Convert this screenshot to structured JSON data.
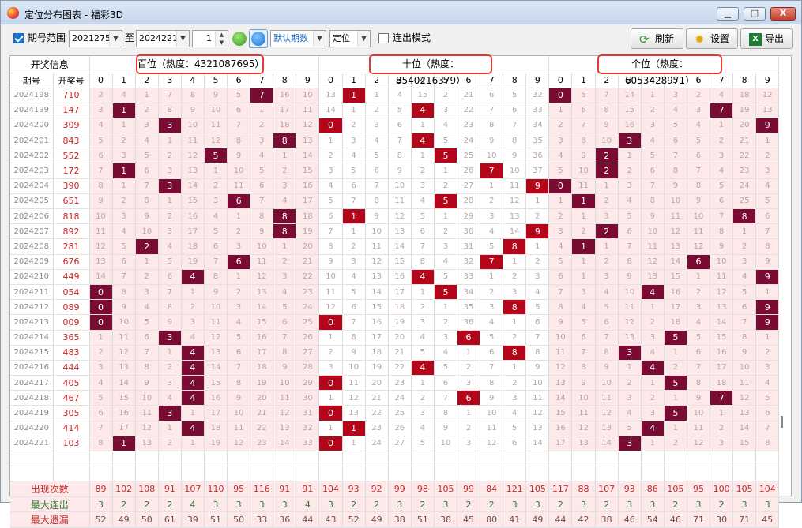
{
  "window": {
    "title": "定位分布图表 - 福彩3D",
    "min": "▁",
    "max": "□",
    "close": "X"
  },
  "toolbar": {
    "period_range_label": "期号范围",
    "from": "2021275",
    "to_label": "至",
    "to": "2024221",
    "step": "1",
    "default_periods": "默认期数",
    "position": "定位",
    "consecutive_label": "连出模式",
    "refresh": "刷新",
    "settings": "设置",
    "export": "导出"
  },
  "table": {
    "info_header": "开奖信息",
    "col_period": "期号",
    "col_number": "开奖号",
    "groups": [
      {
        "label": "百位（热度：4321087695）"
      },
      {
        "label": "十位（热度：8540216379）"
      },
      {
        "label": "个位（热度：6053428971）"
      }
    ],
    "digits": [
      "0",
      "1",
      "2",
      "3",
      "4",
      "5",
      "6",
      "7",
      "8",
      "9"
    ],
    "rows": [
      {
        "period": "2024198",
        "number": "710",
        "cells": [
          [
            2,
            4,
            1,
            7,
            8,
            9,
            5,
            7,
            16,
            10
          ],
          [
            13,
            1,
            1,
            4,
            15,
            2,
            21,
            6,
            5,
            32
          ],
          [
            0,
            5,
            7,
            14,
            1,
            3,
            2,
            4,
            18,
            12
          ]
        ]
      },
      {
        "period": "2024199",
        "number": "147",
        "cells": [
          [
            3,
            1,
            2,
            8,
            9,
            10,
            6,
            1,
            17,
            11
          ],
          [
            14,
            1,
            2,
            5,
            4,
            3,
            22,
            7,
            6,
            33
          ],
          [
            1,
            6,
            8,
            15,
            2,
            4,
            3,
            7,
            19,
            13
          ]
        ]
      },
      {
        "period": "2024200",
        "number": "309",
        "cells": [
          [
            4,
            1,
            3,
            3,
            10,
            11,
            7,
            2,
            18,
            12
          ],
          [
            0,
            2,
            3,
            6,
            1,
            4,
            23,
            8,
            7,
            34
          ],
          [
            2,
            7,
            9,
            16,
            3,
            5,
            4,
            1,
            20,
            9
          ]
        ]
      },
      {
        "period": "2024201",
        "number": "843",
        "cells": [
          [
            5,
            2,
            4,
            1,
            11,
            12,
            8,
            3,
            8,
            13
          ],
          [
            1,
            3,
            4,
            7,
            4,
            5,
            24,
            9,
            8,
            35
          ],
          [
            3,
            8,
            10,
            3,
            4,
            6,
            5,
            2,
            21,
            1
          ]
        ]
      },
      {
        "period": "2024202",
        "number": "552",
        "cells": [
          [
            6,
            3,
            5,
            2,
            12,
            5,
            9,
            4,
            1,
            14
          ],
          [
            2,
            4,
            5,
            8,
            1,
            5,
            25,
            10,
            9,
            36
          ],
          [
            4,
            9,
            2,
            1,
            5,
            7,
            6,
            3,
            22,
            2
          ]
        ]
      },
      {
        "period": "2024203",
        "number": "172",
        "cells": [
          [
            7,
            1,
            6,
            3,
            13,
            1,
            10,
            5,
            2,
            15
          ],
          [
            3,
            5,
            6,
            9,
            2,
            1,
            26,
            7,
            10,
            37
          ],
          [
            5,
            10,
            2,
            2,
            6,
            8,
            7,
            4,
            23,
            3
          ]
        ]
      },
      {
        "period": "2024204",
        "number": "390",
        "cells": [
          [
            8,
            1,
            7,
            3,
            14,
            2,
            11,
            6,
            3,
            16
          ],
          [
            4,
            6,
            7,
            10,
            3,
            2,
            27,
            1,
            11,
            9
          ],
          [
            0,
            11,
            1,
            3,
            7,
            9,
            8,
            5,
            24,
            4
          ]
        ]
      },
      {
        "period": "2024205",
        "number": "651",
        "cells": [
          [
            9,
            2,
            8,
            1,
            15,
            3,
            6,
            7,
            4,
            17
          ],
          [
            5,
            7,
            8,
            11,
            4,
            5,
            28,
            2,
            12,
            1
          ],
          [
            1,
            1,
            2,
            4,
            8,
            10,
            9,
            6,
            25,
            5
          ]
        ]
      },
      {
        "period": "2024206",
        "number": "818",
        "cells": [
          [
            10,
            3,
            9,
            2,
            16,
            4,
            1,
            8,
            8,
            18
          ],
          [
            6,
            1,
            9,
            12,
            5,
            1,
            29,
            3,
            13,
            2
          ],
          [
            2,
            1,
            3,
            5,
            9,
            11,
            10,
            7,
            8,
            6
          ]
        ]
      },
      {
        "period": "2024207",
        "number": "892",
        "cells": [
          [
            11,
            4,
            10,
            3,
            17,
            5,
            2,
            9,
            8,
            19
          ],
          [
            7,
            1,
            10,
            13,
            6,
            2,
            30,
            4,
            14,
            9
          ],
          [
            3,
            2,
            2,
            6,
            10,
            12,
            11,
            8,
            1,
            7
          ]
        ]
      },
      {
        "period": "2024208",
        "number": "281",
        "cells": [
          [
            12,
            5,
            2,
            4,
            18,
            6,
            3,
            10,
            1,
            20
          ],
          [
            8,
            2,
            11,
            14,
            7,
            3,
            31,
            5,
            8,
            1
          ],
          [
            4,
            1,
            1,
            7,
            11,
            13,
            12,
            9,
            2,
            8
          ]
        ]
      },
      {
        "period": "2024209",
        "number": "676",
        "cells": [
          [
            13,
            6,
            1,
            5,
            19,
            7,
            6,
            11,
            2,
            21
          ],
          [
            9,
            3,
            12,
            15,
            8,
            4,
            32,
            7,
            1,
            2
          ],
          [
            5,
            1,
            2,
            8,
            12,
            14,
            6,
            10,
            3,
            9
          ]
        ]
      },
      {
        "period": "2024210",
        "number": "449",
        "cells": [
          [
            14,
            7,
            2,
            6,
            4,
            8,
            1,
            12,
            3,
            22
          ],
          [
            10,
            4,
            13,
            16,
            4,
            5,
            33,
            1,
            2,
            3
          ],
          [
            6,
            1,
            3,
            9,
            13,
            15,
            1,
            11,
            4,
            9
          ]
        ]
      },
      {
        "period": "2024211",
        "number": "054",
        "cells": [
          [
            0,
            8,
            3,
            7,
            1,
            9,
            2,
            13,
            4,
            23
          ],
          [
            11,
            5,
            14,
            17,
            1,
            5,
            34,
            2,
            3,
            4
          ],
          [
            7,
            3,
            4,
            10,
            4,
            16,
            2,
            12,
            5,
            1
          ]
        ]
      },
      {
        "period": "2024212",
        "number": "089",
        "cells": [
          [
            0,
            9,
            4,
            8,
            2,
            10,
            3,
            14,
            5,
            24
          ],
          [
            12,
            6,
            15,
            18,
            2,
            1,
            35,
            3,
            8,
            5
          ],
          [
            8,
            4,
            5,
            11,
            1,
            17,
            3,
            13,
            6,
            9
          ]
        ]
      },
      {
        "period": "2024213",
        "number": "009",
        "cells": [
          [
            0,
            10,
            5,
            9,
            3,
            11,
            4,
            15,
            6,
            25
          ],
          [
            0,
            7,
            16,
            19,
            3,
            2,
            36,
            4,
            1,
            6
          ],
          [
            9,
            5,
            6,
            12,
            2,
            18,
            4,
            14,
            7,
            9
          ]
        ]
      },
      {
        "period": "2024214",
        "number": "365",
        "cells": [
          [
            1,
            11,
            6,
            3,
            4,
            12,
            5,
            16,
            7,
            26
          ],
          [
            1,
            8,
            17,
            20,
            4,
            3,
            6,
            5,
            2,
            7
          ],
          [
            10,
            6,
            7,
            13,
            3,
            5,
            5,
            15,
            8,
            1
          ]
        ]
      },
      {
        "period": "2024215",
        "number": "483",
        "cells": [
          [
            2,
            12,
            7,
            1,
            4,
            13,
            6,
            17,
            8,
            27
          ],
          [
            2,
            9,
            18,
            21,
            5,
            4,
            1,
            6,
            8,
            8
          ],
          [
            11,
            7,
            8,
            3,
            4,
            1,
            6,
            16,
            9,
            2
          ]
        ]
      },
      {
        "period": "2024216",
        "number": "444",
        "cells": [
          [
            3,
            13,
            8,
            2,
            4,
            14,
            7,
            18,
            9,
            28
          ],
          [
            3,
            10,
            19,
            22,
            4,
            5,
            2,
            7,
            1,
            9
          ],
          [
            12,
            8,
            9,
            1,
            4,
            2,
            7,
            17,
            10,
            3
          ]
        ]
      },
      {
        "period": "2024217",
        "number": "405",
        "cells": [
          [
            4,
            14,
            9,
            3,
            4,
            15,
            8,
            19,
            10,
            29
          ],
          [
            0,
            11,
            20,
            23,
            1,
            6,
            3,
            8,
            2,
            10
          ],
          [
            13,
            9,
            10,
            2,
            1,
            5,
            8,
            18,
            11,
            4
          ]
        ]
      },
      {
        "period": "2024218",
        "number": "467",
        "cells": [
          [
            5,
            15,
            10,
            4,
            4,
            16,
            9,
            20,
            11,
            30
          ],
          [
            1,
            12,
            21,
            24,
            2,
            7,
            6,
            9,
            3,
            11
          ],
          [
            14,
            10,
            11,
            3,
            2,
            1,
            9,
            7,
            12,
            5
          ]
        ]
      },
      {
        "period": "2024219",
        "number": "305",
        "cells": [
          [
            6,
            16,
            11,
            3,
            1,
            17,
            10,
            21,
            12,
            31
          ],
          [
            0,
            13,
            22,
            25,
            3,
            8,
            1,
            10,
            4,
            12
          ],
          [
            15,
            11,
            12,
            4,
            3,
            5,
            10,
            1,
            13,
            6
          ]
        ]
      },
      {
        "period": "2024220",
        "number": "414",
        "cells": [
          [
            7,
            17,
            12,
            1,
            4,
            18,
            11,
            22,
            13,
            32
          ],
          [
            1,
            1,
            23,
            26,
            4,
            9,
            2,
            11,
            5,
            13
          ],
          [
            16,
            12,
            13,
            5,
            4,
            1,
            11,
            2,
            14,
            7
          ]
        ]
      },
      {
        "period": "2024221",
        "number": "103",
        "cells": [
          [
            8,
            1,
            13,
            2,
            1,
            19,
            12,
            23,
            14,
            33
          ],
          [
            0,
            1,
            24,
            27,
            5,
            10,
            3,
            12,
            6,
            14
          ],
          [
            17,
            13,
            14,
            3,
            1,
            2,
            12,
            3,
            15,
            8
          ]
        ]
      }
    ],
    "hits": [
      [
        7,
        1,
        0
      ],
      [
        1,
        4,
        7
      ],
      [
        3,
        0,
        9
      ],
      [
        8,
        4,
        3
      ],
      [
        5,
        5,
        2
      ],
      [
        1,
        7,
        2
      ],
      [
        3,
        9,
        0
      ],
      [
        6,
        5,
        1
      ],
      [
        8,
        1,
        8
      ],
      [
        8,
        9,
        2
      ],
      [
        2,
        8,
        1
      ],
      [
        6,
        7,
        6
      ],
      [
        4,
        4,
        9
      ],
      [
        0,
        5,
        4
      ],
      [
        0,
        8,
        9
      ],
      [
        0,
        0,
        9
      ],
      [
        3,
        6,
        5
      ],
      [
        4,
        8,
        3
      ],
      [
        4,
        4,
        4
      ],
      [
        4,
        0,
        5
      ],
      [
        4,
        6,
        7
      ],
      [
        3,
        0,
        5
      ],
      [
        4,
        1,
        4
      ],
      [
        1,
        0,
        3
      ]
    ],
    "stats": [
      {
        "label": "出现次数",
        "values": [
          89,
          102,
          108,
          91,
          107,
          110,
          95,
          116,
          91,
          91,
          104,
          93,
          92,
          99,
          98,
          105,
          99,
          84,
          121,
          105,
          117,
          88,
          107,
          93,
          86,
          105,
          95,
          100,
          105,
          104
        ]
      },
      {
        "label": "最大连出",
        "values": [
          3,
          2,
          2,
          2,
          4,
          3,
          3,
          3,
          3,
          4,
          3,
          2,
          2,
          3,
          2,
          3,
          2,
          2,
          3,
          3,
          2,
          3,
          2,
          3,
          3,
          2,
          3,
          2,
          3,
          3
        ]
      },
      {
        "label": "最大遗漏",
        "values": [
          52,
          49,
          50,
          61,
          39,
          51,
          50,
          33,
          36,
          44,
          43,
          52,
          49,
          38,
          51,
          38,
          45,
          80,
          41,
          49,
          44,
          42,
          38,
          46,
          54,
          46,
          71,
          30,
          71,
          45
        ]
      }
    ]
  },
  "colors": {
    "hit": "#7a0c33",
    "hit_alt": "#b3061a",
    "pink": "#fde8ea",
    "accent_red": "#e53935"
  }
}
